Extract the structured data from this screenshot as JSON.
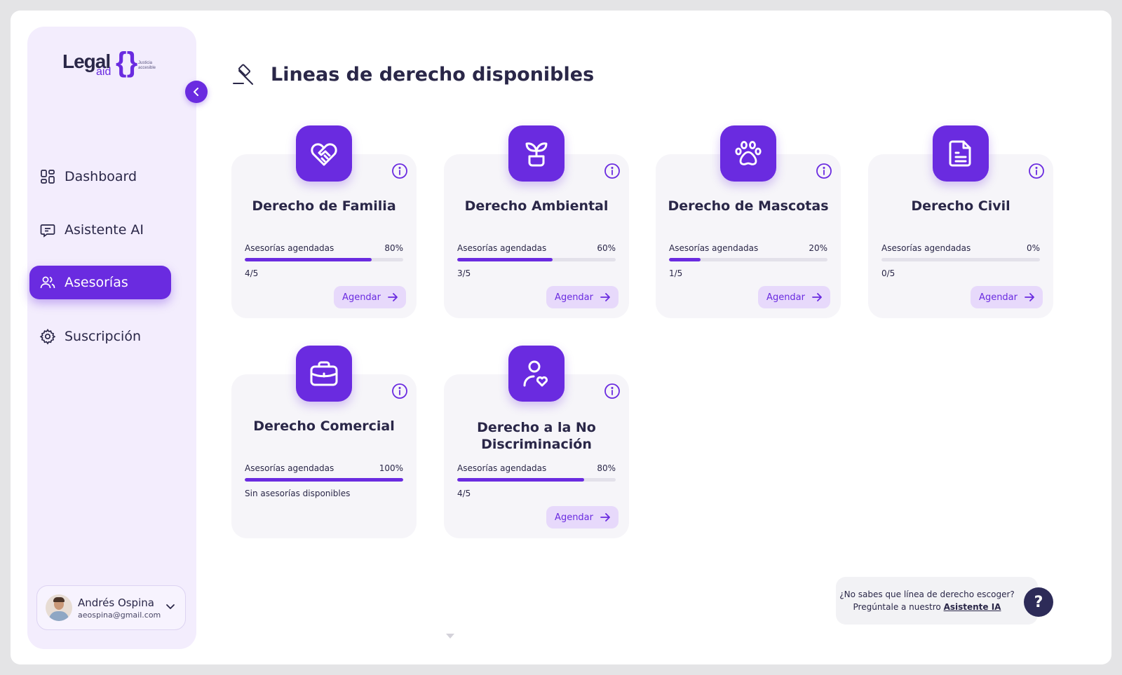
{
  "brand": {
    "name_main": "Legal",
    "name_sub": "aid",
    "tagline_line1": "Justicia",
    "tagline_line2": "accesible"
  },
  "sidebar": {
    "items": [
      {
        "label": "Dashboard",
        "icon": "dashboard-icon",
        "active": false
      },
      {
        "label": "Asistente AI",
        "icon": "chat-icon",
        "active": false
      },
      {
        "label": "Asesorías",
        "icon": "users-icon",
        "active": true
      },
      {
        "label": "Suscripción",
        "icon": "gear-icon",
        "active": false
      }
    ],
    "user": {
      "name": "Andrés Ospina",
      "email": "aeospina@gmail.com"
    }
  },
  "main": {
    "title": "Lineas de derecho disponibles",
    "title_icon": "gavel-icon",
    "cards": [
      {
        "title": "Derecho de Familia",
        "icon": "heart-handshake-icon",
        "label": "Asesorías agendadas",
        "percent": "80%",
        "progress": 0.8,
        "count": "4/5",
        "button": "Agendar"
      },
      {
        "title": "Derecho Ambiental",
        "icon": "plant-icon",
        "label": "Asesorías agendadas",
        "percent": "60%",
        "progress": 0.6,
        "count": "3/5",
        "button": "Agendar"
      },
      {
        "title": "Derecho de Mascotas",
        "icon": "paw-icon",
        "label": "Asesorías agendadas",
        "percent": "20%",
        "progress": 0.2,
        "count": "1/5",
        "button": "Agendar"
      },
      {
        "title": "Derecho Civil",
        "icon": "document-icon",
        "label": "Asesorías agendadas",
        "percent": "0%",
        "progress": 0.0,
        "count": "0/5",
        "button": "Agendar"
      },
      {
        "title": "Derecho Comercial",
        "icon": "briefcase-icon",
        "label": "Asesorías agendadas",
        "percent": "100%",
        "progress": 1.0,
        "count": "Sin asesorías disponibles",
        "button": ""
      },
      {
        "title": "Derecho a la No Discriminación",
        "icon": "user-heart-icon",
        "label": "Asesorías agendadas",
        "percent": "80%",
        "progress": 0.8,
        "count": "4/5",
        "button": "Agendar"
      }
    ]
  },
  "help": {
    "line1": "¿No sabes que línea de derecho escoger?",
    "line2_prefix": "Pregúntale a nuestro ",
    "link": "Asistente IA",
    "button": "?"
  },
  "colors": {
    "accent": "#6a2be0",
    "sidebar_bg": "#f3edfd",
    "dark_navy": "#2d2b58"
  }
}
